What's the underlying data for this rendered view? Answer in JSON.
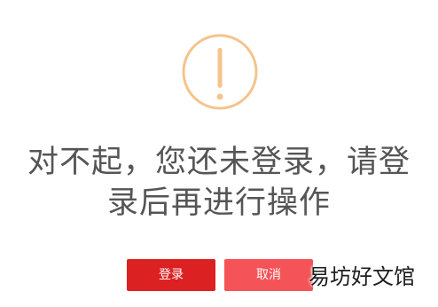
{
  "alert": {
    "icon": "exclamation-circle-icon",
    "color": "#f4c48c"
  },
  "message": {
    "line1": "对不起，您还未登录，请登",
    "line2": "录后再进行操作"
  },
  "buttons": {
    "login_label": "登录",
    "login_color": "#dc2122",
    "cancel_label": "取消",
    "cancel_color": "#f45457"
  },
  "watermark": {
    "text": "易坊好文馆"
  }
}
